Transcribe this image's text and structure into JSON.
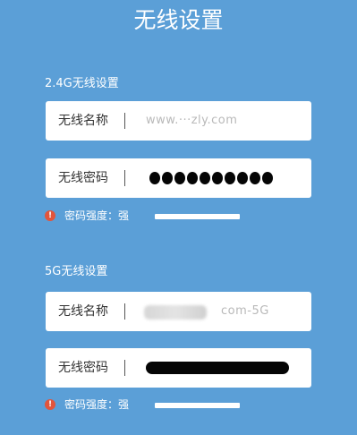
{
  "page": {
    "title": "无线设置"
  },
  "band_24g": {
    "section_label": "2.4G无线设置",
    "ssid_label": "无线名称",
    "ssid_value": "www.···zly.com",
    "password_label": "无线密码",
    "strength_label": "密码强度：强",
    "strength_level": 1.0
  },
  "band_5g": {
    "section_label": "5G无线设置",
    "ssid_label": "无线名称",
    "ssid_value": "com-5G",
    "password_label": "无线密码",
    "strength_label": "密码强度：强",
    "strength_level": 1.0
  },
  "colors": {
    "background": "#5b9fd7",
    "warning": "#e2553c",
    "field_bg": "#ffffff"
  },
  "icons": {
    "warning": "exclamation-circle"
  }
}
